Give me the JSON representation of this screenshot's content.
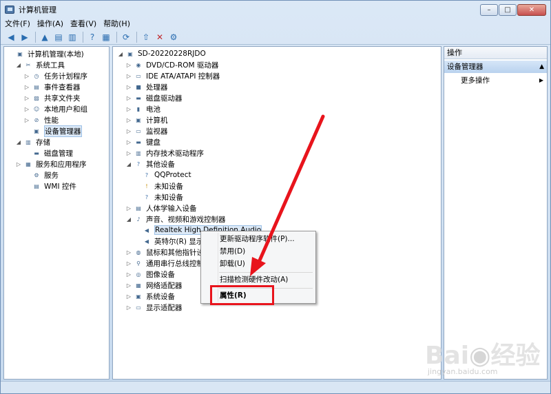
{
  "window": {
    "title": "计算机管理",
    "caption": {
      "minimize": "–",
      "maximize": "□",
      "close": "✕"
    }
  },
  "menubar": [
    "文件(F)",
    "操作(A)",
    "查看(V)",
    "帮助(H)"
  ],
  "left_tree": [
    {
      "label": "计算机管理(本地)",
      "level": 0,
      "twisty": "",
      "icon": "computer-mgmt-icon",
      "glyph": "▣"
    },
    {
      "label": "系统工具",
      "level": 1,
      "twisty": "◢",
      "icon": "tools-icon",
      "glyph": "✂"
    },
    {
      "label": "任务计划程序",
      "level": 2,
      "twisty": "▷",
      "icon": "clock-icon",
      "glyph": "◷"
    },
    {
      "label": "事件查看器",
      "level": 2,
      "twisty": "▷",
      "icon": "event-viewer-icon",
      "glyph": "▤"
    },
    {
      "label": "共享文件夹",
      "level": 2,
      "twisty": "▷",
      "icon": "shared-folder-icon",
      "glyph": "▨"
    },
    {
      "label": "本地用户和组",
      "level": 2,
      "twisty": "▷",
      "icon": "users-icon",
      "glyph": "☺"
    },
    {
      "label": "性能",
      "level": 2,
      "twisty": "▷",
      "icon": "performance-icon",
      "glyph": "⊘"
    },
    {
      "label": "设备管理器",
      "level": 2,
      "twisty": "",
      "icon": "device-manager-icon",
      "glyph": "▣",
      "selected": true
    },
    {
      "label": "存储",
      "level": 1,
      "twisty": "◢",
      "icon": "storage-icon",
      "glyph": "▥"
    },
    {
      "label": "磁盘管理",
      "level": 2,
      "twisty": "",
      "icon": "disk-mgmt-icon",
      "glyph": "▬"
    },
    {
      "label": "服务和应用程序",
      "level": 1,
      "twisty": "▷",
      "icon": "services-apps-icon",
      "glyph": "▦"
    },
    {
      "label": "服务",
      "level": 2,
      "twisty": "",
      "icon": "services-icon",
      "glyph": "⚙"
    },
    {
      "label": "WMI 控件",
      "level": 2,
      "twisty": "",
      "icon": "wmi-icon",
      "glyph": "▤"
    }
  ],
  "device_tree": [
    {
      "label": "SD-20220228RJDO",
      "level": 0,
      "twisty": "◢",
      "icon": "computer-icon",
      "glyph": "▣"
    },
    {
      "label": "DVD/CD-ROM 驱动器",
      "level": 1,
      "twisty": "▷",
      "icon": "dvd-icon",
      "glyph": "◉"
    },
    {
      "label": "IDE ATA/ATAPI 控制器",
      "level": 1,
      "twisty": "▷",
      "icon": "ide-icon",
      "glyph": "▭"
    },
    {
      "label": "处理器",
      "level": 1,
      "twisty": "▷",
      "icon": "processor-icon",
      "glyph": "■"
    },
    {
      "label": "磁盘驱动器",
      "level": 1,
      "twisty": "▷",
      "icon": "disk-icon",
      "glyph": "▬"
    },
    {
      "label": "电池",
      "level": 1,
      "twisty": "▷",
      "icon": "battery-icon",
      "glyph": "▮"
    },
    {
      "label": "计算机",
      "level": 1,
      "twisty": "▷",
      "icon": "computer-small-icon",
      "glyph": "▣"
    },
    {
      "label": "监视器",
      "level": 1,
      "twisty": "▷",
      "icon": "monitor-icon",
      "glyph": "▭"
    },
    {
      "label": "键盘",
      "level": 1,
      "twisty": "▷",
      "icon": "keyboard-icon",
      "glyph": "▬"
    },
    {
      "label": "内存技术驱动程序",
      "level": 1,
      "twisty": "▷",
      "icon": "memory-icon",
      "glyph": "▥"
    },
    {
      "label": "其他设备",
      "level": 1,
      "twisty": "◢",
      "icon": "other-devices-icon",
      "glyph": "?"
    },
    {
      "label": "QQProtect",
      "level": 2,
      "twisty": "",
      "icon": "unknown-device-icon",
      "glyph": "?"
    },
    {
      "label": "未知设备",
      "level": 2,
      "twisty": "",
      "icon": "warning-device-icon",
      "glyph": "!"
    },
    {
      "label": "未知设备",
      "level": 2,
      "twisty": "",
      "icon": "unknown-device-icon",
      "glyph": "?"
    },
    {
      "label": "人体学输入设备",
      "level": 1,
      "twisty": "▷",
      "icon": "hid-icon",
      "glyph": "▤"
    },
    {
      "label": "声音、视频和游戏控制器",
      "level": 1,
      "twisty": "◢",
      "icon": "sound-icon",
      "glyph": "♪"
    },
    {
      "label": "Realtek High Definition Audio",
      "level": 2,
      "twisty": "",
      "icon": "speaker-icon",
      "glyph": "◀",
      "selected": true
    },
    {
      "label": "英特尔(R) 显示",
      "level": 2,
      "twisty": "",
      "icon": "speaker-icon",
      "glyph": "◀"
    },
    {
      "label": "鼠标和其他指针设",
      "level": 1,
      "twisty": "▷",
      "icon": "mouse-icon",
      "glyph": "◍"
    },
    {
      "label": "通用串行总线控制",
      "level": 1,
      "twisty": "▷",
      "icon": "usb-icon",
      "glyph": "⚲"
    },
    {
      "label": "图像设备",
      "level": 1,
      "twisty": "▷",
      "icon": "camera-icon",
      "glyph": "◎"
    },
    {
      "label": "网络适配器",
      "level": 1,
      "twisty": "▷",
      "icon": "network-icon",
      "glyph": "▦"
    },
    {
      "label": "系统设备",
      "level": 1,
      "twisty": "▷",
      "icon": "system-device-icon",
      "glyph": "▣"
    },
    {
      "label": "显示适配器",
      "level": 1,
      "twisty": "▷",
      "icon": "display-adapter-icon",
      "glyph": "▭"
    }
  ],
  "actions_pane": {
    "header": "操作",
    "section": "设备管理器",
    "more": "更多操作"
  },
  "context_menu": [
    {
      "label": "更新驱动程序软件(P)..."
    },
    {
      "label": "禁用(D)"
    },
    {
      "label": "卸载(U)"
    },
    {
      "label": "扫描检测硬件改动(A)"
    },
    {
      "label": "属性(R)",
      "bold": true
    }
  ],
  "watermark": {
    "logo": "Bai 经验",
    "url": "jingyan.baidu.com"
  },
  "colors": {
    "annotation": "#e8141c",
    "selection": "#dce9f7"
  }
}
